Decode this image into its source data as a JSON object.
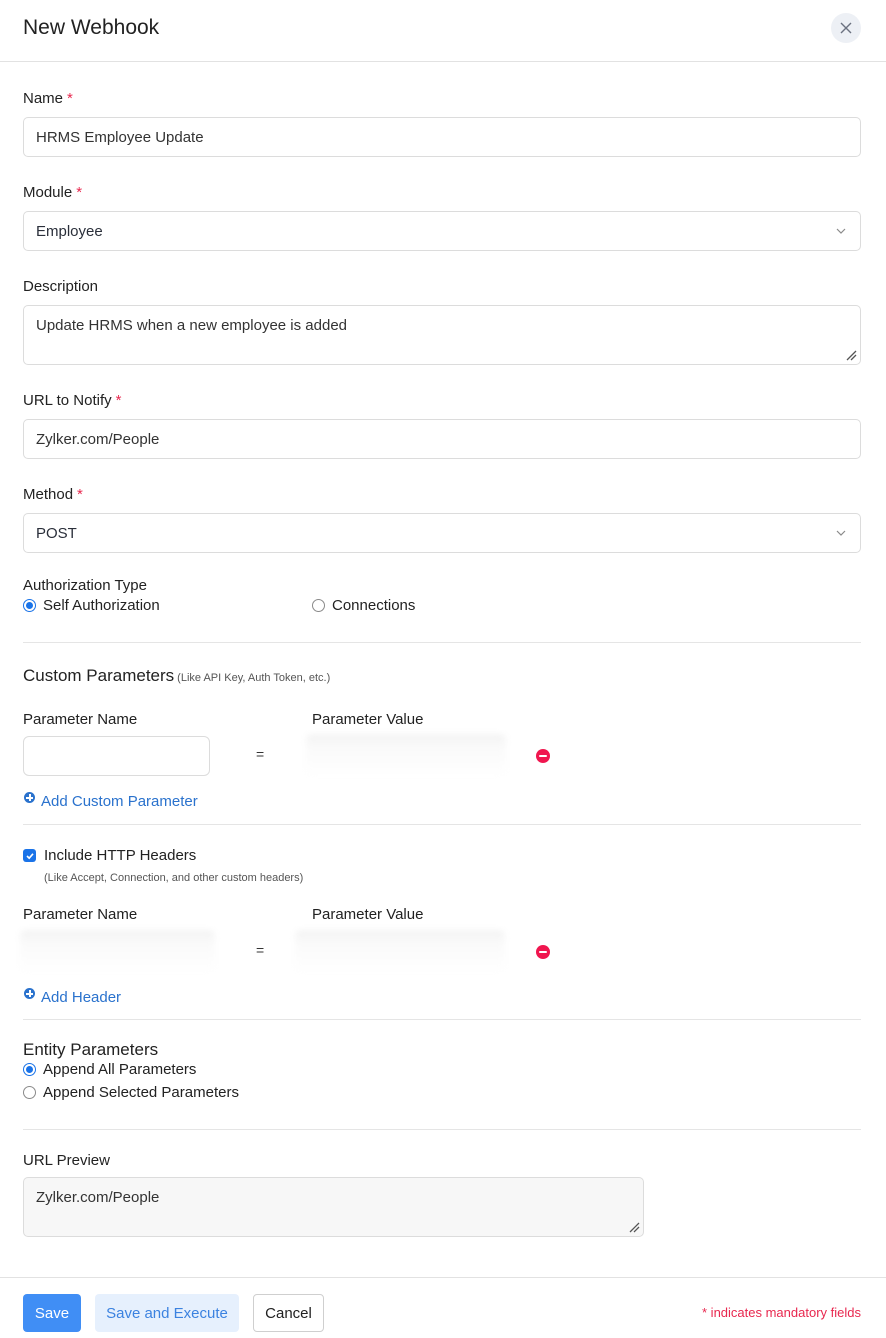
{
  "header": {
    "title": "New Webhook",
    "close_icon": "close-icon"
  },
  "form": {
    "name": {
      "label": "Name",
      "required_mark": "*",
      "value": "HRMS Employee Update"
    },
    "module": {
      "label": "Module",
      "required_mark": "*",
      "value": "Employee"
    },
    "description": {
      "label": "Description",
      "value": "Update HRMS when a new employee is added"
    },
    "url": {
      "label": "URL to Notify",
      "required_mark": "*",
      "value": "Zylker.com/People"
    },
    "method": {
      "label": "Method",
      "required_mark": "*",
      "value": "POST"
    },
    "authorization": {
      "label": "Authorization Type",
      "options": [
        {
          "label": "Self Authorization",
          "selected": true
        },
        {
          "label": "Connections",
          "selected": false
        }
      ]
    },
    "custom_parameters": {
      "title": "Custom Parameters",
      "subtitle": "(Like API Key, Auth Token, etc.)",
      "name_header": "Parameter Name",
      "value_header": "Parameter Value",
      "equals": "=",
      "rows": [
        {
          "name": "",
          "value": ""
        }
      ],
      "add_label": "Add Custom Parameter"
    },
    "http_headers": {
      "checkbox_label": "Include HTTP Headers",
      "checked": true,
      "hint": "(Like Accept, Connection, and other custom headers)",
      "name_header": "Parameter Name",
      "value_header": "Parameter Value",
      "equals": "=",
      "rows": [
        {
          "name": "",
          "value": ""
        }
      ],
      "add_label": "Add Header"
    },
    "entity_parameters": {
      "title": "Entity Parameters",
      "options": [
        {
          "label": "Append All Parameters",
          "selected": true
        },
        {
          "label": "Append Selected Parameters",
          "selected": false
        }
      ]
    },
    "url_preview": {
      "label": "URL Preview",
      "value": "Zylker.com/People"
    }
  },
  "footer": {
    "save_label": "Save",
    "save_execute_label": "Save and Execute",
    "cancel_label": "Cancel",
    "mandatory_note": "* indicates mandatory fields"
  },
  "colors": {
    "primary": "#408ef5",
    "required": "#e8284f",
    "link": "#2a72cd",
    "remove": "#f0164f"
  }
}
